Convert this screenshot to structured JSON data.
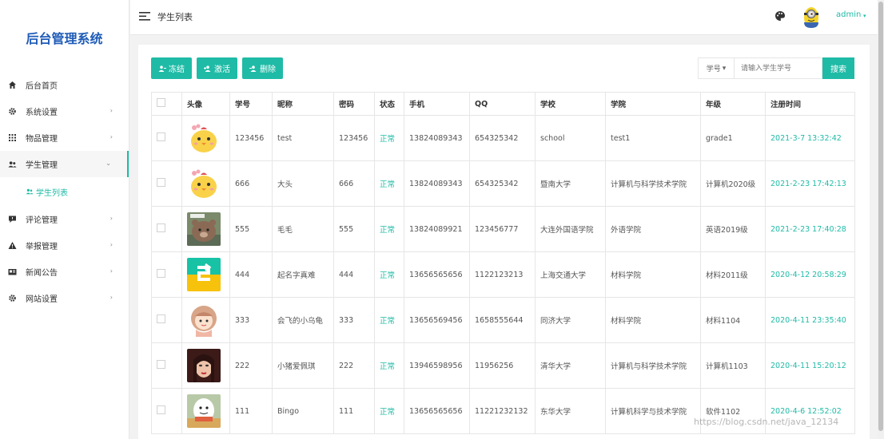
{
  "brand": {
    "title": "后台管理系统"
  },
  "sidebar": {
    "items": [
      {
        "label": "后台首页",
        "icon": "home-icon",
        "arrow": ""
      },
      {
        "label": "系统设置",
        "icon": "gear-icon",
        "arrow": "›"
      },
      {
        "label": "物品管理",
        "icon": "grid-icon",
        "arrow": "›"
      },
      {
        "label": "学生管理",
        "icon": "users-icon",
        "arrow": "⌄"
      },
      {
        "label": "评论管理",
        "icon": "comment-icon",
        "arrow": "›"
      },
      {
        "label": "举报管理",
        "icon": "warning-icon",
        "arrow": "›"
      },
      {
        "label": "新闻公告",
        "icon": "news-icon",
        "arrow": "›"
      },
      {
        "label": "网站设置",
        "icon": "gear-icon",
        "arrow": "›"
      }
    ],
    "sub_item": {
      "label": "学生列表",
      "icon": "users-icon"
    }
  },
  "topbar": {
    "page_title": "学生列表",
    "user_name": "admin",
    "caret": "▾"
  },
  "toolbar": {
    "freeze_label": "冻结",
    "activate_label": "激活",
    "delete_label": "删除"
  },
  "search": {
    "select_label": "学号",
    "select_caret": "▾",
    "placeholder": "请输入学生学号",
    "button_label": "搜索"
  },
  "table": {
    "headers": [
      "",
      "头像",
      "学号",
      "昵称",
      "密码",
      "状态",
      "手机",
      "QQ",
      "学校",
      "学院",
      "年级",
      "注册时间"
    ],
    "rows": [
      {
        "avatar": "chick",
        "id": "123456",
        "nickname": "test",
        "password": "123456",
        "status": "正常",
        "phone": "13824089343",
        "qq": "654325342",
        "school": "school",
        "college": "test1",
        "grade": "grade1",
        "time": "2021-3-7 13:32:42"
      },
      {
        "avatar": "chick",
        "id": "666",
        "nickname": "大头",
        "password": "666",
        "status": "正常",
        "phone": "13824089343",
        "qq": "654325342",
        "school": "暨南大学",
        "college": "计算机与科学技术学院",
        "grade": "计算机2020级",
        "time": "2021-2-23 17:42:13"
      },
      {
        "avatar": "bear",
        "id": "555",
        "nickname": "毛毛",
        "password": "555",
        "status": "正常",
        "phone": "13824089921",
        "qq": "123456777",
        "school": "大连外国语学院",
        "college": "外语学院",
        "grade": "英语2019级",
        "time": "2021-2-23 17:40:28"
      },
      {
        "avatar": "logo",
        "id": "444",
        "nickname": "起名字真难",
        "password": "444",
        "status": "正常",
        "phone": "13656565656",
        "qq": "1122123213",
        "school": "上海交通大学",
        "college": "材料学院",
        "grade": "材料2011级",
        "time": "2020-4-12 20:58:29"
      },
      {
        "avatar": "girl",
        "id": "333",
        "nickname": "会飞的小乌龟",
        "password": "333",
        "status": "正常",
        "phone": "13656569456",
        "qq": "1658555644",
        "school": "同济大学",
        "college": "材料学院",
        "grade": "材料1104",
        "time": "2020-4-11 23:35:40"
      },
      {
        "avatar": "photo",
        "id": "222",
        "nickname": "小猪爱佩琪",
        "password": "222",
        "status": "正常",
        "phone": "13946598956",
        "qq": "11956256",
        "school": "清华大学",
        "college": "计算机与科学技术学院",
        "grade": "计算机1103",
        "time": "2020-4-11 15:20:12"
      },
      {
        "avatar": "cartoon",
        "id": "111",
        "nickname": "Bingo",
        "password": "111",
        "status": "正常",
        "phone": "13656565656",
        "qq": "11221232132",
        "school": "东华大学",
        "college": "计算机科学与技术学院",
        "grade": "软件1102",
        "time": "2020-4-6 12:52:02"
      }
    ]
  },
  "watermark": "https://blog.csdn.net/java_12134",
  "colors": {
    "accent": "#1fbba6",
    "brand": "#1e5bb8"
  }
}
